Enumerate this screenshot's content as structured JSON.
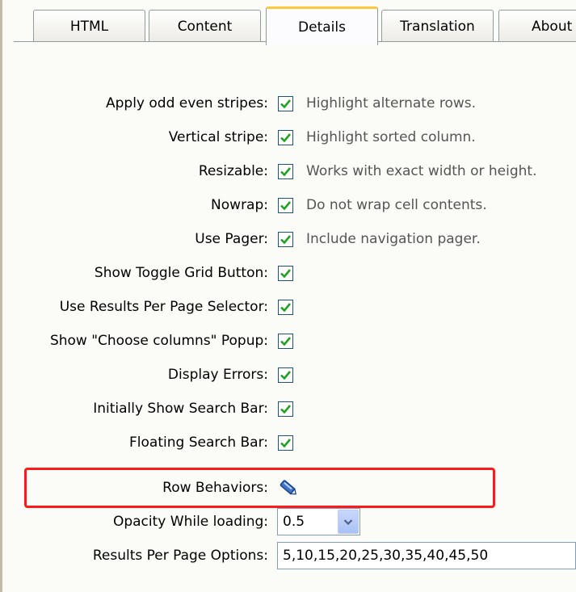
{
  "tabs": [
    {
      "label": "HTML",
      "active": false
    },
    {
      "label": "Content",
      "active": false
    },
    {
      "label": "Details",
      "active": true
    },
    {
      "label": "Translation",
      "active": false
    },
    {
      "label": "About",
      "active": false
    }
  ],
  "settings": [
    {
      "label": "Apply odd even stripes:",
      "checked": true,
      "hint": "Highlight alternate rows."
    },
    {
      "label": "Vertical stripe:",
      "checked": true,
      "hint": "Highlight sorted column."
    },
    {
      "label": "Resizable:",
      "checked": true,
      "hint": "Works with exact width or height."
    },
    {
      "label": "Nowrap:",
      "checked": true,
      "hint": "Do not wrap cell contents."
    },
    {
      "label": "Use Pager:",
      "checked": true,
      "hint": "Include navigation pager."
    },
    {
      "label": "Show Toggle Grid Button:",
      "checked": true,
      "hint": ""
    },
    {
      "label": "Use Results Per Page Selector:",
      "checked": true,
      "hint": ""
    },
    {
      "label": "Show \"Choose columns\" Popup:",
      "checked": true,
      "hint": ""
    },
    {
      "label": "Display Errors:",
      "checked": true,
      "hint": ""
    },
    {
      "label": "Initially Show Search Bar:",
      "checked": true,
      "hint": ""
    },
    {
      "label": "Floating Search Bar:",
      "checked": true,
      "hint": ""
    }
  ],
  "row_behaviors": {
    "label": "Row Behaviors:",
    "icon": "pencil-edit-icon"
  },
  "opacity": {
    "label": "Opacity While loading:",
    "value": "0.5"
  },
  "results_per_page": {
    "label": "Results Per Page Options:",
    "value": "5,10,15,20,25,30,35,40,45,50"
  },
  "colors": {
    "highlight_border": "#ff1a1a",
    "check": "#21a121",
    "active_tab_accent": "#ffc83c"
  }
}
